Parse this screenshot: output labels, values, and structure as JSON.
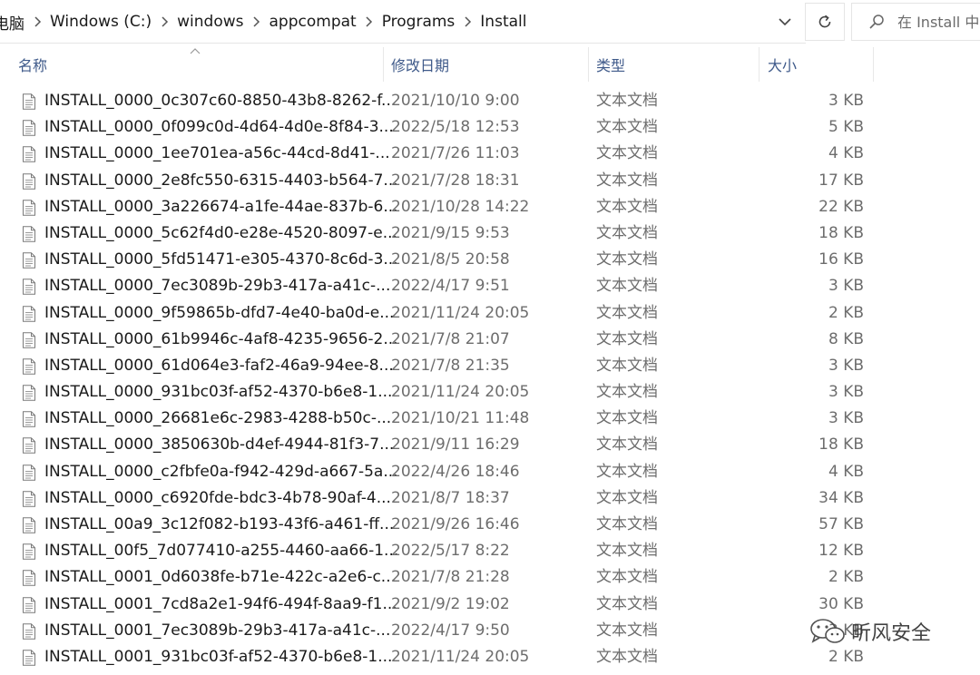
{
  "breadcrumb": {
    "items": [
      "电脑",
      "Windows (C:)",
      "windows",
      "appcompat",
      "Programs",
      "Install"
    ]
  },
  "search": {
    "placeholder": "在 Install 中搜索"
  },
  "columns": {
    "name": "名称",
    "modified": "修改日期",
    "type": "类型",
    "size": "大小"
  },
  "files": [
    {
      "name": "INSTALL_0000_0c307c60-8850-43b8-8262-f...",
      "modified": "2021/10/10 9:00",
      "type": "文本文档",
      "size": "3 KB"
    },
    {
      "name": "INSTALL_0000_0f099c0d-4d64-4d0e-8f84-3...",
      "modified": "2022/5/18 12:53",
      "type": "文本文档",
      "size": "5 KB"
    },
    {
      "name": "INSTALL_0000_1ee701ea-a56c-44cd-8d41-...",
      "modified": "2021/7/26 11:03",
      "type": "文本文档",
      "size": "4 KB"
    },
    {
      "name": "INSTALL_0000_2e8fc550-6315-4403-b564-7...",
      "modified": "2021/7/28 18:31",
      "type": "文本文档",
      "size": "17 KB"
    },
    {
      "name": "INSTALL_0000_3a226674-a1fe-44ae-837b-6...",
      "modified": "2021/10/28 14:22",
      "type": "文本文档",
      "size": "22 KB"
    },
    {
      "name": "INSTALL_0000_5c62f4d0-e28e-4520-8097-e...",
      "modified": "2021/9/15 9:53",
      "type": "文本文档",
      "size": "18 KB"
    },
    {
      "name": "INSTALL_0000_5fd51471-e305-4370-8c6d-3...",
      "modified": "2021/8/5 20:58",
      "type": "文本文档",
      "size": "16 KB"
    },
    {
      "name": "INSTALL_0000_7ec3089b-29b3-417a-a41c-...",
      "modified": "2022/4/17 9:51",
      "type": "文本文档",
      "size": "3 KB"
    },
    {
      "name": "INSTALL_0000_9f59865b-dfd7-4e40-ba0d-e...",
      "modified": "2021/11/24 20:05",
      "type": "文本文档",
      "size": "2 KB"
    },
    {
      "name": "INSTALL_0000_61b9946c-4af8-4235-9656-2...",
      "modified": "2021/7/8 21:07",
      "type": "文本文档",
      "size": "8 KB"
    },
    {
      "name": "INSTALL_0000_61d064e3-faf2-46a9-94ee-8...",
      "modified": "2021/7/8 21:35",
      "type": "文本文档",
      "size": "3 KB"
    },
    {
      "name": "INSTALL_0000_931bc03f-af52-4370-b6e8-1...",
      "modified": "2021/11/24 20:05",
      "type": "文本文档",
      "size": "3 KB"
    },
    {
      "name": "INSTALL_0000_26681e6c-2983-4288-b50c-...",
      "modified": "2021/10/21 11:48",
      "type": "文本文档",
      "size": "3 KB"
    },
    {
      "name": "INSTALL_0000_3850630b-d4ef-4944-81f3-7...",
      "modified": "2021/9/11 16:29",
      "type": "文本文档",
      "size": "18 KB"
    },
    {
      "name": "INSTALL_0000_c2fbfe0a-f942-429d-a667-5a...",
      "modified": "2022/4/26 18:46",
      "type": "文本文档",
      "size": "4 KB"
    },
    {
      "name": "INSTALL_0000_c6920fde-bdc3-4b78-90af-4...",
      "modified": "2021/8/7 18:37",
      "type": "文本文档",
      "size": "34 KB"
    },
    {
      "name": "INSTALL_00a9_3c12f082-b193-43f6-a461-ff...",
      "modified": "2021/9/26 16:46",
      "type": "文本文档",
      "size": "57 KB"
    },
    {
      "name": "INSTALL_00f5_7d077410-a255-4460-aa66-1...",
      "modified": "2022/5/17 8:22",
      "type": "文本文档",
      "size": "12 KB"
    },
    {
      "name": "INSTALL_0001_0d6038fe-b71e-422c-a2e6-c...",
      "modified": "2021/7/8 21:28",
      "type": "文本文档",
      "size": "2 KB"
    },
    {
      "name": "INSTALL_0001_7cd8a2e1-94f6-494f-8aa9-f1...",
      "modified": "2021/9/2 19:02",
      "type": "文本文档",
      "size": "30 KB"
    },
    {
      "name": "INSTALL_0001_7ec3089b-29b3-417a-a41c-...",
      "modified": "2022/4/17 9:50",
      "type": "文本文档",
      "size": "3 KB"
    },
    {
      "name": "INSTALL_0001_931bc03f-af52-4370-b6e8-1...",
      "modified": "2021/11/24 20:05",
      "type": "文本文档",
      "size": "2 KB"
    }
  ],
  "watermark": {
    "text": "昕风安全"
  }
}
